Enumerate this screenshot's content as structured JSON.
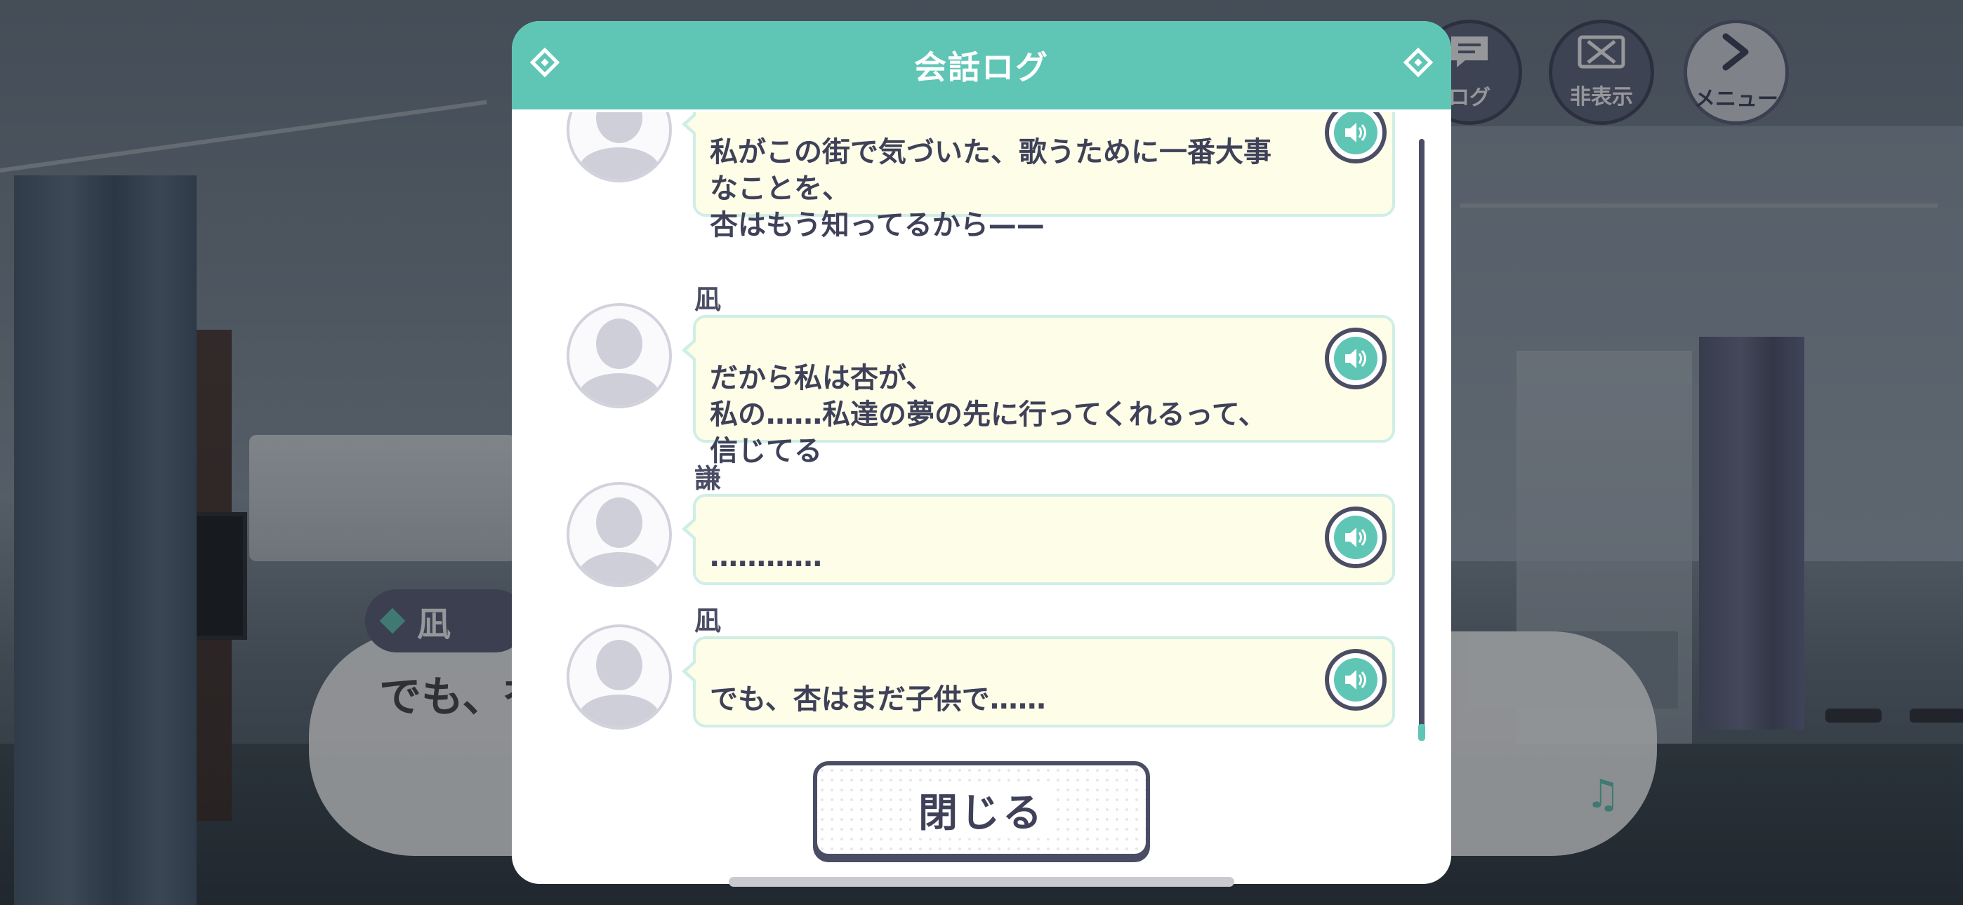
{
  "background": {
    "speaker_name": "凪",
    "dialogue_text": "でも、杏",
    "note_icon": "music-note-icon"
  },
  "top_buttons": {
    "log": {
      "label": "ログ",
      "icon": "chat-bubble-icon"
    },
    "hide": {
      "label": "非表示",
      "icon": "close-box-icon"
    },
    "menu": {
      "label": "メニュー",
      "icon": "chevron-right-icon"
    }
  },
  "log_modal": {
    "title": "会話ログ",
    "close_label": "閉じる",
    "accent_color": "#5fc6b6",
    "entries": [
      {
        "speaker": "",
        "text": "私がこの街で気づいた、歌うために一番大事\nなことを、\n杏はもう知ってるから——"
      },
      {
        "speaker": "凪",
        "text": "だから私は杏が、\n私の……私達の夢の先に行ってくれるって、\n信じてる"
      },
      {
        "speaker": "謙",
        "text": "…………"
      },
      {
        "speaker": "凪",
        "text": "でも、杏はまだ子供で……"
      }
    ]
  }
}
